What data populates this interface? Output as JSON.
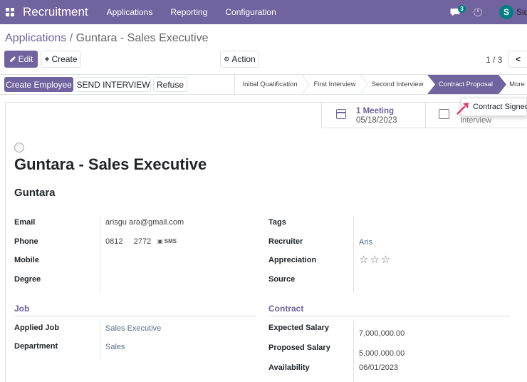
{
  "navbar": {
    "brand": "Recruitment",
    "menu": [
      "Applications",
      "Reporting",
      "Configuration"
    ],
    "chat_count": "3",
    "user_initial": "S",
    "user_name": "Sid"
  },
  "breadcrumb": {
    "parent": "Applications",
    "separator": " / ",
    "current": "Guntara - Sales Executive"
  },
  "buttons": {
    "edit": "Edit",
    "create": "Create",
    "action": "Action",
    "create_employee": "Create Employee",
    "send_interview": "SEND INTERVIEW",
    "refuse": "Refuse"
  },
  "pager": {
    "text": "1 / 3",
    "prev": "<"
  },
  "stages": [
    "Initial Qualification",
    "First Interview",
    "Second Interview",
    "Contract Proposal",
    "More"
  ],
  "active_stage": "Contract Proposal",
  "dropdown": {
    "item": "Contract Signed"
  },
  "smart_buttons": {
    "meeting_count": "1 Meeting",
    "meeting_date": "05/18/2023",
    "interview_label": "Interview"
  },
  "form": {
    "title": "Guntara - Sales Executive",
    "applicant": "Guntara",
    "left": {
      "email_label": "Email",
      "email_value": "arisgu   ara@gmail.com",
      "phone_label": "Phone",
      "phone_value": "0812     2772",
      "sms": "SMS",
      "mobile_label": "Mobile",
      "degree_label": "Degree"
    },
    "right": {
      "tags_label": "Tags",
      "recruiter_label": "Recruiter",
      "recruiter_value": "Aris",
      "appreciation_label": "Appreciation",
      "appreciation_stars": "☆☆☆",
      "source_label": "Source"
    },
    "job": {
      "section": "Job",
      "applied_job_label": "Applied Job",
      "applied_job_value": "Sales Executive",
      "department_label": "Department",
      "department_value": "Sales"
    },
    "contract": {
      "section": "Contract",
      "expected_label": "Expected Salary",
      "expected_value": "7,000,000.00",
      "proposed_label": "Proposed Salary",
      "proposed_value": "5,000,000.00",
      "availability_label": "Availability",
      "availability_value": "06/01/2023"
    }
  },
  "colors": {
    "brand": "#71639e",
    "teal": "#017e84",
    "arrow": "#e5396b"
  }
}
